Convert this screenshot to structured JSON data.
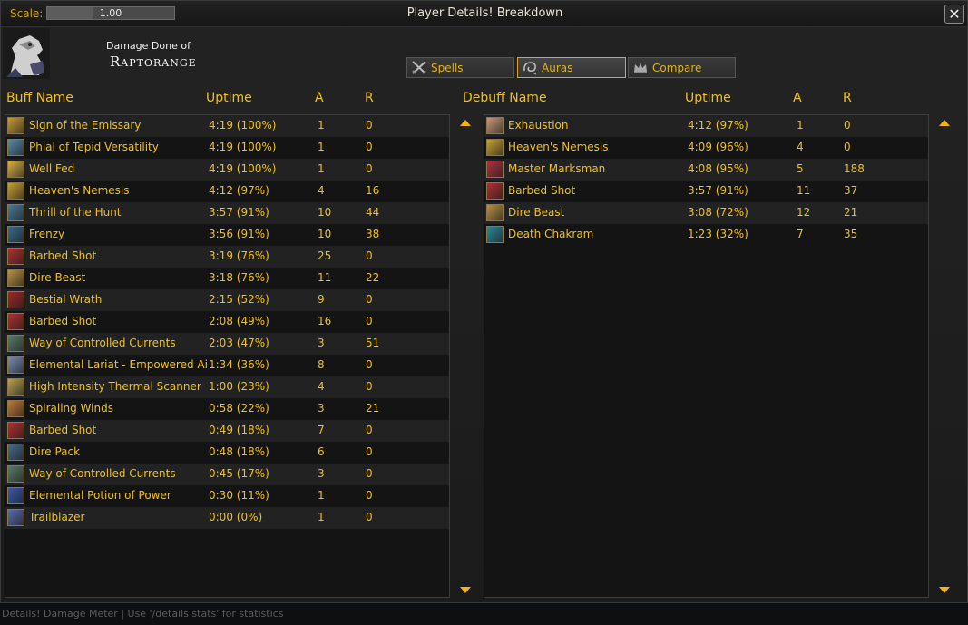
{
  "window": {
    "title": "Player Details! Breakdown",
    "scale_label": "Scale:",
    "scale_value": "1.00",
    "scale_fill": 0.36,
    "close_icon": "close-x-icon"
  },
  "header": {
    "damage_label": "Damage Done of",
    "player_name": "Raptorange"
  },
  "tabs": [
    {
      "label": "Spells",
      "icon": "crossed-swords-icon",
      "active": false
    },
    {
      "label": "Auras",
      "icon": "auras-swirl-icon",
      "active": true
    },
    {
      "label": "Compare",
      "icon": "crown-icon",
      "active": false
    }
  ],
  "buffs": {
    "headers": {
      "name": "Buff Name",
      "uptime": "Uptime",
      "a": "A",
      "r": "R"
    },
    "rows": [
      {
        "name": "Sign of the Emissary",
        "uptime": "4:19 (100%)",
        "a": "1",
        "r": "0",
        "icon": "emissary-icon",
        "color": "#c89a38"
      },
      {
        "name": "Phial of Tepid Versatility",
        "uptime": "4:19 (100%)",
        "a": "1",
        "r": "0",
        "icon": "phial-icon",
        "color": "#5a8aa8"
      },
      {
        "name": "Well Fed",
        "uptime": "4:19 (100%)",
        "a": "1",
        "r": "0",
        "icon": "food-icon",
        "color": "#d8b040"
      },
      {
        "name": "Heaven's Nemesis",
        "uptime": "4:12 (97%)",
        "a": "4",
        "r": "16",
        "icon": "nemesis-icon",
        "color": "#c8a030"
      },
      {
        "name": "Thrill of the Hunt",
        "uptime": "3:57 (91%)",
        "a": "10",
        "r": "44",
        "icon": "thrill-icon",
        "color": "#4a7a9a"
      },
      {
        "name": "Frenzy",
        "uptime": "3:56 (91%)",
        "a": "10",
        "r": "38",
        "icon": "frenzy-icon",
        "color": "#3a6a8a"
      },
      {
        "name": "Barbed Shot",
        "uptime": "3:19 (76%)",
        "a": "25",
        "r": "0",
        "icon": "barbed-shot-icon",
        "color": "#b03030"
      },
      {
        "name": "Dire Beast",
        "uptime": "3:18 (76%)",
        "a": "11",
        "r": "22",
        "icon": "dire-beast-icon",
        "color": "#b89040"
      },
      {
        "name": "Bestial Wrath",
        "uptime": "2:15 (52%)",
        "a": "9",
        "r": "0",
        "icon": "bestial-wrath-icon",
        "color": "#a02828"
      },
      {
        "name": "Barbed Shot",
        "uptime": "2:08 (49%)",
        "a": "16",
        "r": "0",
        "icon": "barbed-shot-icon",
        "color": "#b03030"
      },
      {
        "name": "Way of Controlled Currents",
        "uptime": "2:03 (47%)",
        "a": "3",
        "r": "51",
        "icon": "currents-icon",
        "color": "#5a7a6a"
      },
      {
        "name": "Elemental Lariat - Empowered Air",
        "uptime": "1:34 (36%)",
        "a": "8",
        "r": "0",
        "icon": "lariat-icon",
        "color": "#7a8ab0"
      },
      {
        "name": "High Intensity Thermal Scanner",
        "uptime": "1:00 (23%)",
        "a": "4",
        "r": "0",
        "icon": "scanner-icon",
        "color": "#b8a050"
      },
      {
        "name": "Spiraling Winds",
        "uptime": "0:58 (22%)",
        "a": "3",
        "r": "21",
        "icon": "winds-icon",
        "color": "#c07838"
      },
      {
        "name": "Barbed Shot",
        "uptime": "0:49 (18%)",
        "a": "7",
        "r": "0",
        "icon": "barbed-shot-icon",
        "color": "#b03030"
      },
      {
        "name": "Dire Pack",
        "uptime": "0:48 (18%)",
        "a": "6",
        "r": "0",
        "icon": "dire-pack-icon",
        "color": "#4a6a8a"
      },
      {
        "name": "Way of Controlled Currents",
        "uptime": "0:45 (17%)",
        "a": "3",
        "r": "0",
        "icon": "currents-icon",
        "color": "#5a7a6a"
      },
      {
        "name": "Elemental Potion of Power",
        "uptime": "0:30 (11%)",
        "a": "1",
        "r": "0",
        "icon": "potion-icon",
        "color": "#3a5aa8"
      },
      {
        "name": "Trailblazer",
        "uptime": "0:00 (0%)",
        "a": "1",
        "r": "0",
        "icon": "trailblazer-icon",
        "color": "#5a6ab0"
      }
    ]
  },
  "debuffs": {
    "headers": {
      "name": "Debuff Name",
      "uptime": "Uptime",
      "a": "A",
      "r": "R"
    },
    "rows": [
      {
        "name": "Exhaustion",
        "uptime": "4:12 (97%)",
        "a": "1",
        "r": "0",
        "icon": "exhaustion-icon",
        "color": "#c89878"
      },
      {
        "name": "Heaven's Nemesis",
        "uptime": "4:09 (96%)",
        "a": "4",
        "r": "0",
        "icon": "nemesis-icon",
        "color": "#c8a030"
      },
      {
        "name": "Master Marksman",
        "uptime": "4:08 (95%)",
        "a": "5",
        "r": "188",
        "icon": "marksman-icon",
        "color": "#b03040"
      },
      {
        "name": "Barbed Shot",
        "uptime": "3:57 (91%)",
        "a": "11",
        "r": "37",
        "icon": "barbed-shot-icon",
        "color": "#b03030"
      },
      {
        "name": "Dire Beast",
        "uptime": "3:08 (72%)",
        "a": "12",
        "r": "21",
        "icon": "dire-beast-icon",
        "color": "#b89040"
      },
      {
        "name": "Death Chakram",
        "uptime": "1:23 (32%)",
        "a": "7",
        "r": "35",
        "icon": "chakram-icon",
        "color": "#2a8a9a"
      }
    ]
  },
  "status": {
    "text": "Details! Damage Meter | Use '/details stats' for statistics"
  }
}
